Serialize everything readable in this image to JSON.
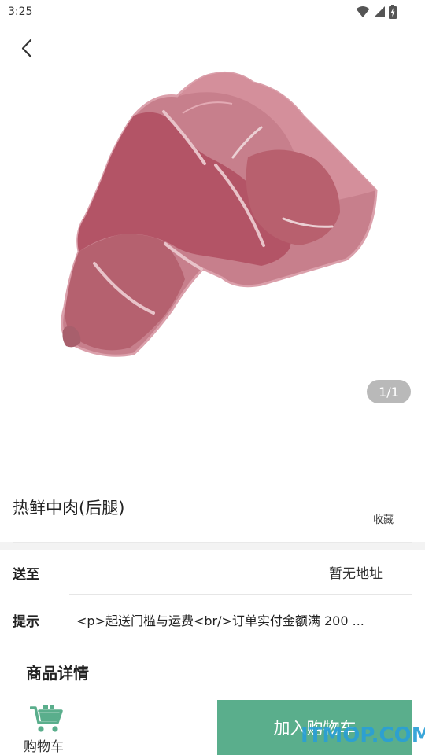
{
  "status_bar": {
    "time": "3:25"
  },
  "gallery": {
    "counter": "1/1"
  },
  "product": {
    "title": "热鲜中肉(后腿)",
    "favorite_label": "收藏"
  },
  "delivery": {
    "label": "送至",
    "value": "暂无地址"
  },
  "tip": {
    "label": "提示",
    "value": "<p>起送门槛与运费<br/>订单实付金额满 200 ..."
  },
  "details": {
    "title": "商品详情"
  },
  "bottom": {
    "cart_label": "购物车",
    "add_to_cart_label": "加入购物车"
  },
  "watermark": "ITMOP.COM",
  "colors": {
    "accent": "#5aae8c",
    "counter_bg": "#b9b9b9",
    "watermark": "#2a9fd6"
  }
}
